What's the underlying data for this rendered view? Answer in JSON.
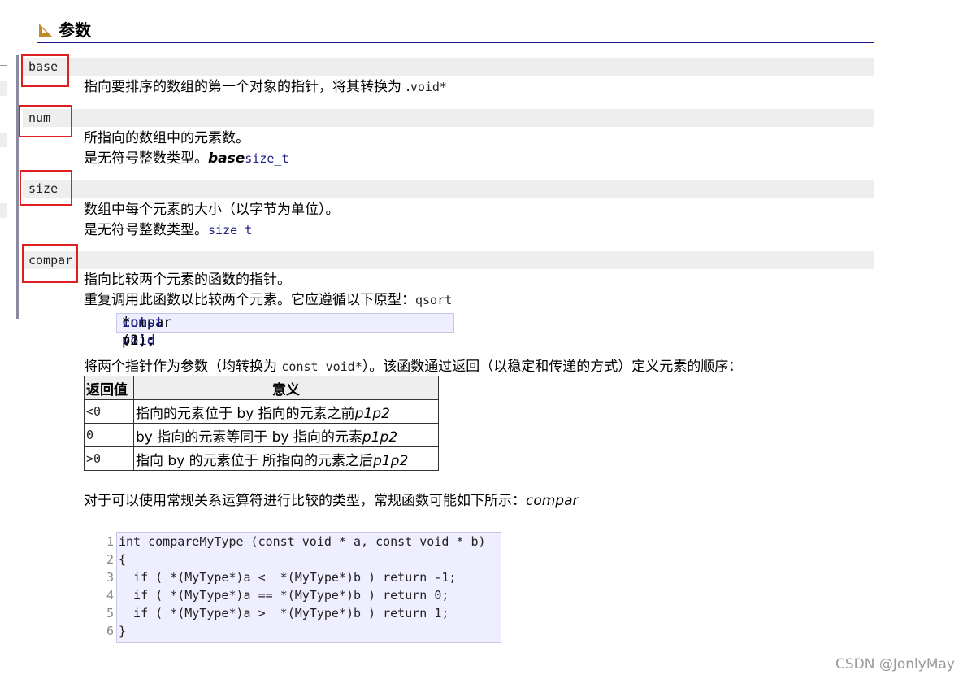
{
  "header": {
    "title": "参数"
  },
  "params": [
    {
      "name": "base",
      "lines": [
        [
          "指向要排序的数组的第一个对象的指针，将其转换为 .",
          "void*"
        ]
      ]
    },
    {
      "name": "num",
      "lines": [
        [
          "所指向的数组中的元素数。"
        ],
        [
          "是无符号整数类型。",
          "base",
          "size_t"
        ]
      ]
    },
    {
      "name": "size",
      "lines": [
        [
          "数组中每个元素的大小（以字节为单位）。"
        ],
        [
          "是无符号整数类型。",
          "size_t"
        ]
      ]
    },
    {
      "name": "compar",
      "lines": [
        [
          "指向比较两个元素的函数的指针。"
        ],
        [
          "重复调用此函数以比较两个元素。它应遵循以下原型：",
          "qsort"
        ]
      ]
    }
  ],
  "prototype": {
    "kw1": "int",
    "mid1": " compar (",
    "kw2": "const void",
    "mid2": "* p1, ",
    "kw3": "const void",
    "end": "* p2);"
  },
  "compar_note": {
    "pre": "将两个指针作为参数（均转换为 ",
    "code": "const void*",
    "post": "）。该函数通过返回（以稳定和传递的方式）定义元素的顺序："
  },
  "return_table": {
    "headers": [
      "返回值",
      "意义"
    ],
    "rows": [
      {
        "ret": "<0",
        "text": "指向的元素位于 by 指向的元素之前",
        "ital": "p1p2"
      },
      {
        "ret": "0",
        "text": "by 指向的元素等同于 by 指向的元素",
        "ital": "p1p2"
      },
      {
        "ret": ">0",
        "text": "指向 by 的元素位于 所指向的元素之后",
        "ital": "p1p2"
      }
    ]
  },
  "typical_note": {
    "text": "对于可以使用常规关系运算符进行比较的类型，常规函数可能如下所示：",
    "ital": "compar"
  },
  "code": {
    "line_numbers": [
      "1",
      "2",
      "3",
      "4",
      "5",
      "6"
    ],
    "lines": [
      "int compareMyType (const void * a, const void * b)",
      "{",
      "  if ( *(MyType*)a <  *(MyType*)b ) return -1;",
      "  if ( *(MyType*)a == *(MyType*)b ) return 0;",
      "  if ( *(MyType*)a >  *(MyType*)b ) return 1;",
      "}"
    ]
  },
  "watermark": "CSDN @JonlyMay",
  "colors": {
    "accent": "#1c1c8c",
    "code": "#20208a",
    "highlight_box": "#e02020",
    "code_bg": "#eeeeff"
  }
}
